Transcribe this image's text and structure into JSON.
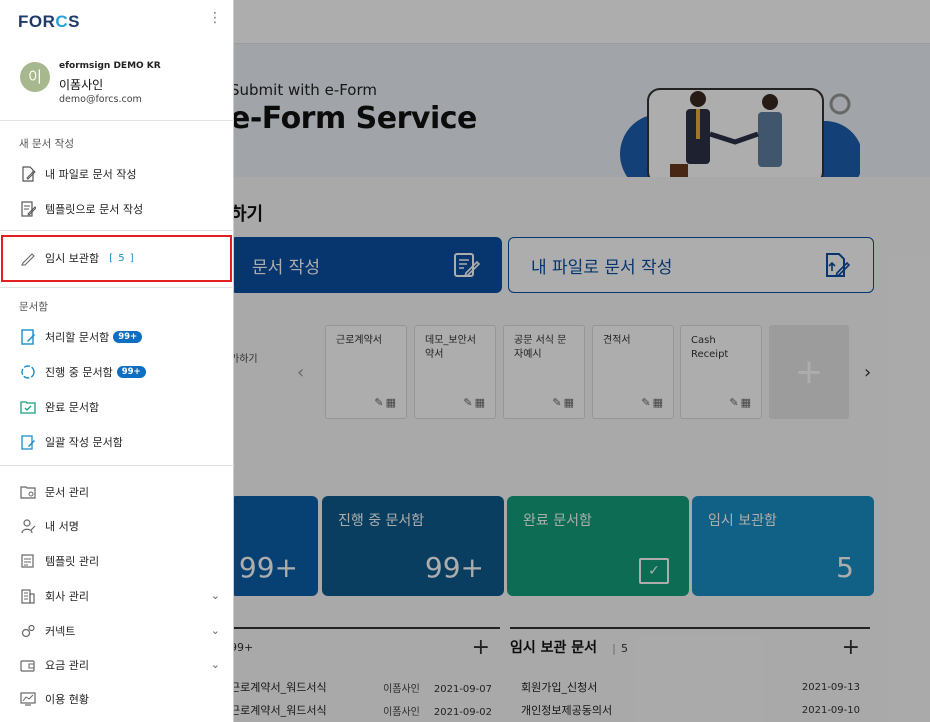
{
  "drawer": {
    "logo_text": "FORCS",
    "user": {
      "avatar_initial": "이",
      "company": "eformsign DEMO KR",
      "name": "이폼사인",
      "email": "demo@forcs.com"
    },
    "new_doc_section": "새 문서 작성",
    "new_doc_items": [
      {
        "label": "내 파일로 문서 작성",
        "icon": "file-edit-icon"
      },
      {
        "label": "템플릿으로 문서 작성",
        "icon": "template-edit-icon"
      }
    ],
    "drafts": {
      "label": "임시 보관함",
      "count": "[ 5 ]",
      "icon": "pencil-icon"
    },
    "docbox_section": "문서함",
    "docbox_items": [
      {
        "label": "처리할 문서함",
        "badge": "99+",
        "icon": "todo-doc-icon"
      },
      {
        "label": "진행 중 문서함",
        "badge": "99+",
        "icon": "progress-cycle-icon"
      },
      {
        "label": "완료 문서함",
        "badge": "",
        "icon": "completed-folder-icon"
      },
      {
        "label": "일괄 작성 문서함",
        "badge": "",
        "icon": "bulk-doc-icon"
      }
    ],
    "manage_items": [
      {
        "label": "문서 관리",
        "icon": "doc-manage-icon",
        "expandable": false
      },
      {
        "label": "내 서명",
        "icon": "signature-icon",
        "expandable": false
      },
      {
        "label": "템플릿 관리",
        "icon": "template-manage-icon",
        "expandable": false
      },
      {
        "label": "회사 관리",
        "icon": "building-icon",
        "expandable": true
      },
      {
        "label": "커넥트",
        "icon": "gears-icon",
        "expandable": true
      },
      {
        "label": "요금 관리",
        "icon": "wallet-icon",
        "expandable": true
      },
      {
        "label": "이용 현황",
        "icon": "usage-chart-icon",
        "expandable": false
      }
    ]
  },
  "main": {
    "hero_subtitle": "Submit with e-Form",
    "hero_title": "e-Form Service",
    "section_title": "하기",
    "btn_template": "문서 작성",
    "btn_myfile": "내 파일로 문서 작성",
    "template_add_label": "가하기",
    "templates": [
      "근로계약서",
      "데모_보안서약서",
      "공문 서식 문자예시",
      "견적서",
      "Cash Receipt"
    ],
    "stats": [
      {
        "label": "",
        "value": "99+"
      },
      {
        "label": "진행 중 문서함",
        "value": "99+"
      },
      {
        "label": "완료 문서함",
        "value": ""
      },
      {
        "label": "임시 보관함",
        "value": "5"
      }
    ],
    "list_left": {
      "count": "99+"
    },
    "list_right": {
      "title": "임시 보관 문서",
      "count": "5"
    },
    "rows_left": [
      {
        "title": "근로계약서_워드서식",
        "who": "이폼사인",
        "date": "2021-09-07"
      },
      {
        "title": "근로계약서_워드서식",
        "who": "이폼사인",
        "date": "2021-09-02"
      }
    ],
    "rows_right": [
      {
        "title": "회원가입_신청서",
        "date": "2021-09-13"
      },
      {
        "title": "개인정보제공동의서",
        "date": "2021-09-10"
      }
    ]
  },
  "colors": {
    "brand_blue": "#0b4ea2",
    "highlight_red": "#e21e1e",
    "badge_blue": "#0e6fc2",
    "green": "#13a07c"
  }
}
